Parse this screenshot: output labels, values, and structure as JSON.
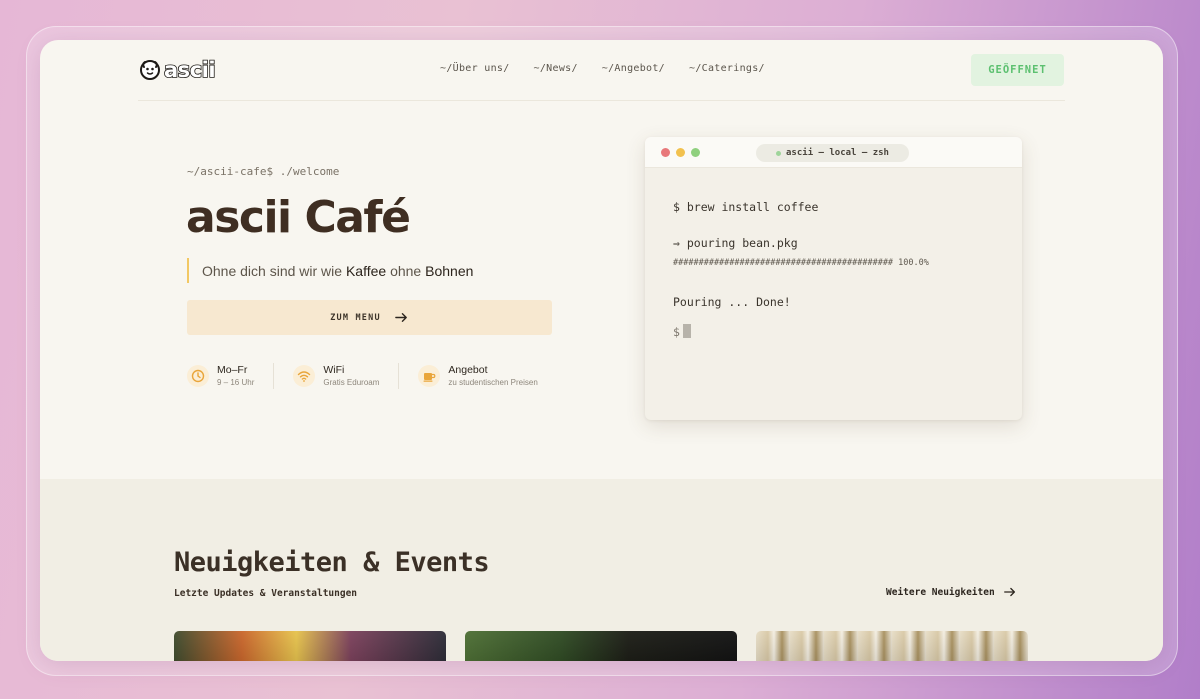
{
  "header": {
    "logo_text": "ascii",
    "nav": [
      {
        "label": "~/Über uns/"
      },
      {
        "label": "~/News/"
      },
      {
        "label": "~/Angebot/"
      },
      {
        "label": "~/Caterings/"
      }
    ],
    "status_badge": "GEÖFFNET"
  },
  "hero": {
    "prompt": "~/ascii-cafe$ ./welcome",
    "title": "ascii Café",
    "tagline_prefix": "Ohne dich sind wir wie ",
    "tagline_word1": "Kaffee",
    "tagline_middle": " ohne ",
    "tagline_word2": "Bohnen",
    "menu_button": "ZUM MENU",
    "info": [
      {
        "icon": "clock-icon",
        "title": "Mo–Fr",
        "sub": "9 – 16 Uhr"
      },
      {
        "icon": "wifi-icon",
        "title": "WiFi",
        "sub": "Gratis Eduroam"
      },
      {
        "icon": "cup-icon",
        "title": "Angebot",
        "sub": "zu studentischen Preisen"
      }
    ]
  },
  "terminal": {
    "title": "ascii — local — zsh",
    "lines": {
      "cmd": "$ brew install coffee",
      "pouring": "⇒ pouring bean.pkg",
      "progress": "########################################### 100.0%",
      "done": "Pouring ... Done!",
      "prompt": "$"
    },
    "colors": {
      "red": "#e8787a",
      "yellow": "#f2c14e",
      "green": "#8fd07e"
    }
  },
  "news": {
    "title": "Neuigkeiten & Events",
    "subtitle": "Letzte Updates & Veranstaltungen",
    "more_link": "Weitere Neuigkeiten"
  },
  "colors": {
    "accent": "#f2c864",
    "brand_brown": "#3f2e22",
    "open_green": "#5cc070",
    "page_bg": "#f8f6f0"
  }
}
